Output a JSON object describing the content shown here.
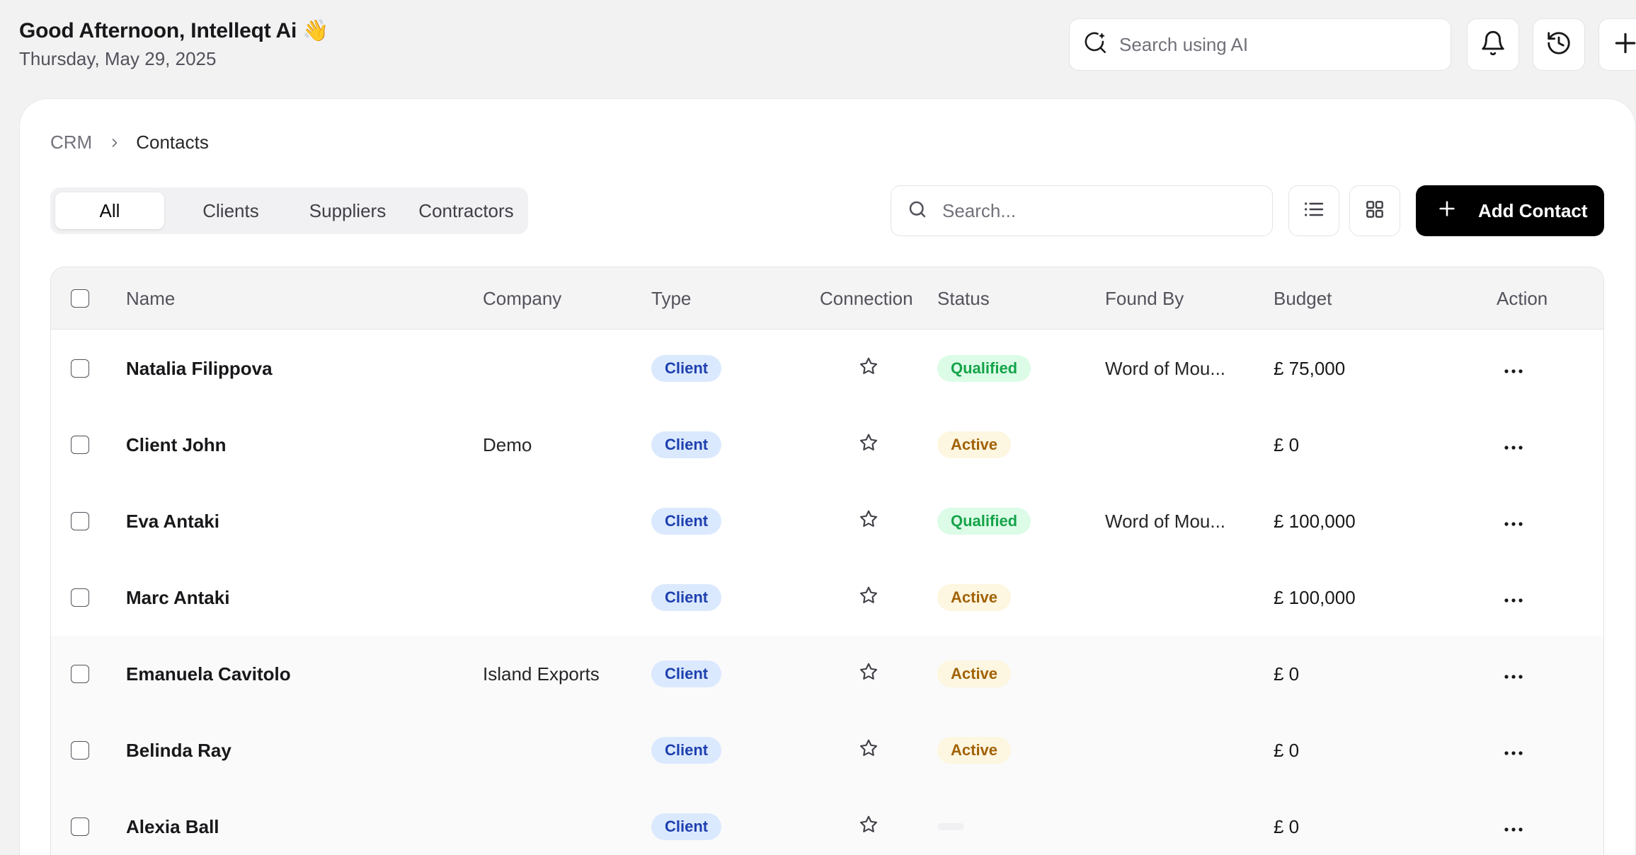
{
  "header": {
    "greeting": "Good Afternoon, Intelleqt Ai 👋",
    "date": "Thursday, May 29, 2025",
    "ai_search_placeholder": "Search using AI"
  },
  "breadcrumb": {
    "root": "CRM",
    "current": "Contacts"
  },
  "tabs": [
    {
      "label": "All",
      "active": true
    },
    {
      "label": "Clients",
      "active": false
    },
    {
      "label": "Suppliers",
      "active": false
    },
    {
      "label": "Contractors",
      "active": false
    }
  ],
  "search": {
    "placeholder": "Search..."
  },
  "add_contact_label": "Add Contact",
  "table": {
    "columns": [
      "Name",
      "Company",
      "Type",
      "Connection",
      "Status",
      "Found By",
      "Budget",
      "Action"
    ],
    "rows": [
      {
        "name": "Natalia Filippova",
        "company": "",
        "type": "Client",
        "status": "Qualified",
        "found_by": "Word of Mou...",
        "budget": "£ 75,000"
      },
      {
        "name": "Client John",
        "company": "Demo",
        "type": "Client",
        "status": "Active",
        "found_by": "",
        "budget": "£ 0"
      },
      {
        "name": "Eva Antaki",
        "company": "",
        "type": "Client",
        "status": "Qualified",
        "found_by": "Word of Mou...",
        "budget": "£ 100,000"
      },
      {
        "name": "Marc Antaki",
        "company": "",
        "type": "Client",
        "status": "Active",
        "found_by": "",
        "budget": "£ 100,000"
      },
      {
        "name": "Emanuela Cavitolo",
        "company": "Island Exports",
        "type": "Client",
        "status": "Active",
        "found_by": "",
        "budget": "£ 0"
      },
      {
        "name": "Belinda Ray",
        "company": "",
        "type": "Client",
        "status": "Active",
        "found_by": "",
        "budget": "£ 0"
      },
      {
        "name": "Alexia Ball",
        "company": "",
        "type": "Client",
        "status": "",
        "found_by": "",
        "budget": "£ 0"
      }
    ]
  },
  "icons": {
    "ai_search": "ai-search-icon",
    "notifications": "bell-icon",
    "history": "history-icon",
    "add": "plus-icon",
    "list_view": "list-view-icon",
    "grid_view": "grid-view-icon",
    "connection": "star-icon",
    "row_action": "more-horizontal-icon"
  },
  "colors": {
    "primary_button": "#000000",
    "type_badge_bg": "#dbe9fe",
    "type_badge_text": "#1e40af",
    "qualified_bg": "#dcfce7",
    "qualified_text": "#16a34a",
    "active_bg": "#fdf6e0",
    "active_text": "#a16207"
  }
}
